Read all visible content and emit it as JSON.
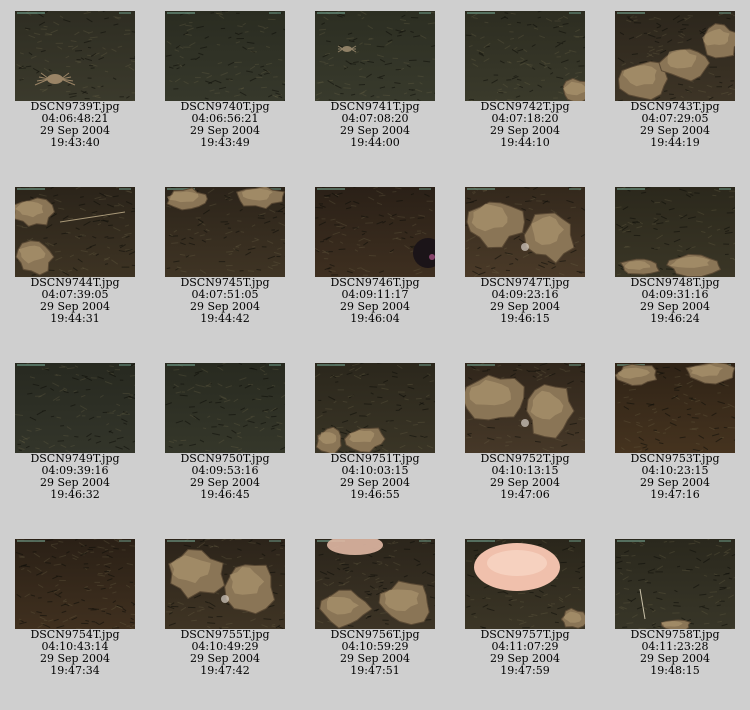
{
  "thumbnails": [
    {
      "filename": "DSCN9739T.jpg",
      "timecode": "04:06:48:21",
      "date": "29 Sep 2004",
      "time": "19:43:40",
      "scene": "crab",
      "palette": [
        "#3b3a2c",
        "#2e2d22"
      ]
    },
    {
      "filename": "DSCN9740T.jpg",
      "timecode": "04:06:56:21",
      "date": "29 Sep 2004",
      "time": "19:43:49",
      "scene": "sediment",
      "palette": [
        "#36382b",
        "#2a2c21"
      ]
    },
    {
      "filename": "DSCN9741T.jpg",
      "timecode": "04:07:08:20",
      "date": "29 Sep 2004",
      "time": "19:44:00",
      "scene": "crab-small",
      "palette": [
        "#383a2c",
        "#2c2e22"
      ]
    },
    {
      "filename": "DSCN9742T.jpg",
      "timecode": "04:07:18:20",
      "date": "29 Sep 2004",
      "time": "19:44:10",
      "scene": "rock-corner",
      "palette": [
        "#3a3a2b",
        "#2d2d21"
      ]
    },
    {
      "filename": "DSCN9743T.jpg",
      "timecode": "04:07:29:05",
      "date": "29 Sep 2004",
      "time": "19:44:19",
      "scene": "rock-ridge",
      "palette": [
        "#3d3426",
        "#2c261c"
      ]
    },
    {
      "filename": "DSCN9744T.jpg",
      "timecode": "04:07:39:05",
      "date": "29 Sep 2004",
      "time": "19:44:31",
      "scene": "rock-left",
      "palette": [
        "#3d3323",
        "#2b241a"
      ]
    },
    {
      "filename": "DSCN9745T.jpg",
      "timecode": "04:07:51:05",
      "date": "29 Sep 2004",
      "time": "19:44:42",
      "scene": "rock-top",
      "palette": [
        "#3f3424",
        "#2c241a"
      ]
    },
    {
      "filename": "DSCN9746T.jpg",
      "timecode": "04:09:11:17",
      "date": "29 Sep 2004",
      "time": "19:46:04",
      "scene": "dark-blob",
      "palette": [
        "#3e2f20",
        "#2a2017"
      ]
    },
    {
      "filename": "DSCN9747T.jpg",
      "timecode": "04:09:23:16",
      "date": "29 Sep 2004",
      "time": "19:46:15",
      "scene": "rock-big",
      "palette": [
        "#4a3a28",
        "#33281c"
      ]
    },
    {
      "filename": "DSCN9748T.jpg",
      "timecode": "04:09:31:16",
      "date": "29 Sep 2004",
      "time": "19:46:24",
      "scene": "rock-bottom",
      "palette": [
        "#3a3626",
        "#2b281c"
      ]
    },
    {
      "filename": "DSCN9749T.jpg",
      "timecode": "04:09:39:16",
      "date": "29 Sep 2004",
      "time": "19:46:32",
      "scene": "sediment",
      "palette": [
        "#33352a",
        "#272920"
      ]
    },
    {
      "filename": "DSCN9750T.jpg",
      "timecode": "04:09:53:16",
      "date": "29 Sep 2004",
      "time": "19:46:45",
      "scene": "sediment",
      "palette": [
        "#35372a",
        "#282a20"
      ]
    },
    {
      "filename": "DSCN9751T.jpg",
      "timecode": "04:10:03:15",
      "date": "29 Sep 2004",
      "time": "19:46:55",
      "scene": "rock-bottom-left",
      "palette": [
        "#3a3526",
        "#2b271c"
      ]
    },
    {
      "filename": "DSCN9752T.jpg",
      "timecode": "04:10:13:15",
      "date": "29 Sep 2004",
      "time": "19:47:06",
      "scene": "rock-big",
      "palette": [
        "#463828",
        "#30261b"
      ]
    },
    {
      "filename": "DSCN9753T.jpg",
      "timecode": "04:10:23:15",
      "date": "29 Sep 2004",
      "time": "19:47:16",
      "scene": "rock-top",
      "palette": [
        "#45331f",
        "#2f2316"
      ]
    },
    {
      "filename": "DSCN9754T.jpg",
      "timecode": "04:10:43:14",
      "date": "29 Sep 2004",
      "time": "19:47:34",
      "scene": "dense",
      "palette": [
        "#40301f",
        "#2a2016"
      ]
    },
    {
      "filename": "DSCN9755T.jpg",
      "timecode": "04:10:49:29",
      "date": "29 Sep 2004",
      "time": "19:47:42",
      "scene": "rock-big",
      "palette": [
        "#3f3424",
        "#2c241a"
      ]
    },
    {
      "filename": "DSCN9756T.jpg",
      "timecode": "04:10:59:29",
      "date": "29 Sep 2004",
      "time": "19:47:51",
      "scene": "sponge-top",
      "palette": [
        "#3d3426",
        "#2b251b"
      ]
    },
    {
      "filename": "DSCN9757T.jpg",
      "timecode": "04:11:07:29",
      "date": "29 Sep 2004",
      "time": "19:47:59",
      "scene": "sponge-big",
      "palette": [
        "#3b3526",
        "#2a261b"
      ]
    },
    {
      "filename": "DSCN9758T.jpg",
      "timecode": "04:11:23:28",
      "date": "29 Sep 2004",
      "time": "19:48:15",
      "scene": "sediment-rock",
      "palette": [
        "#383628",
        "#2a281d"
      ]
    }
  ]
}
